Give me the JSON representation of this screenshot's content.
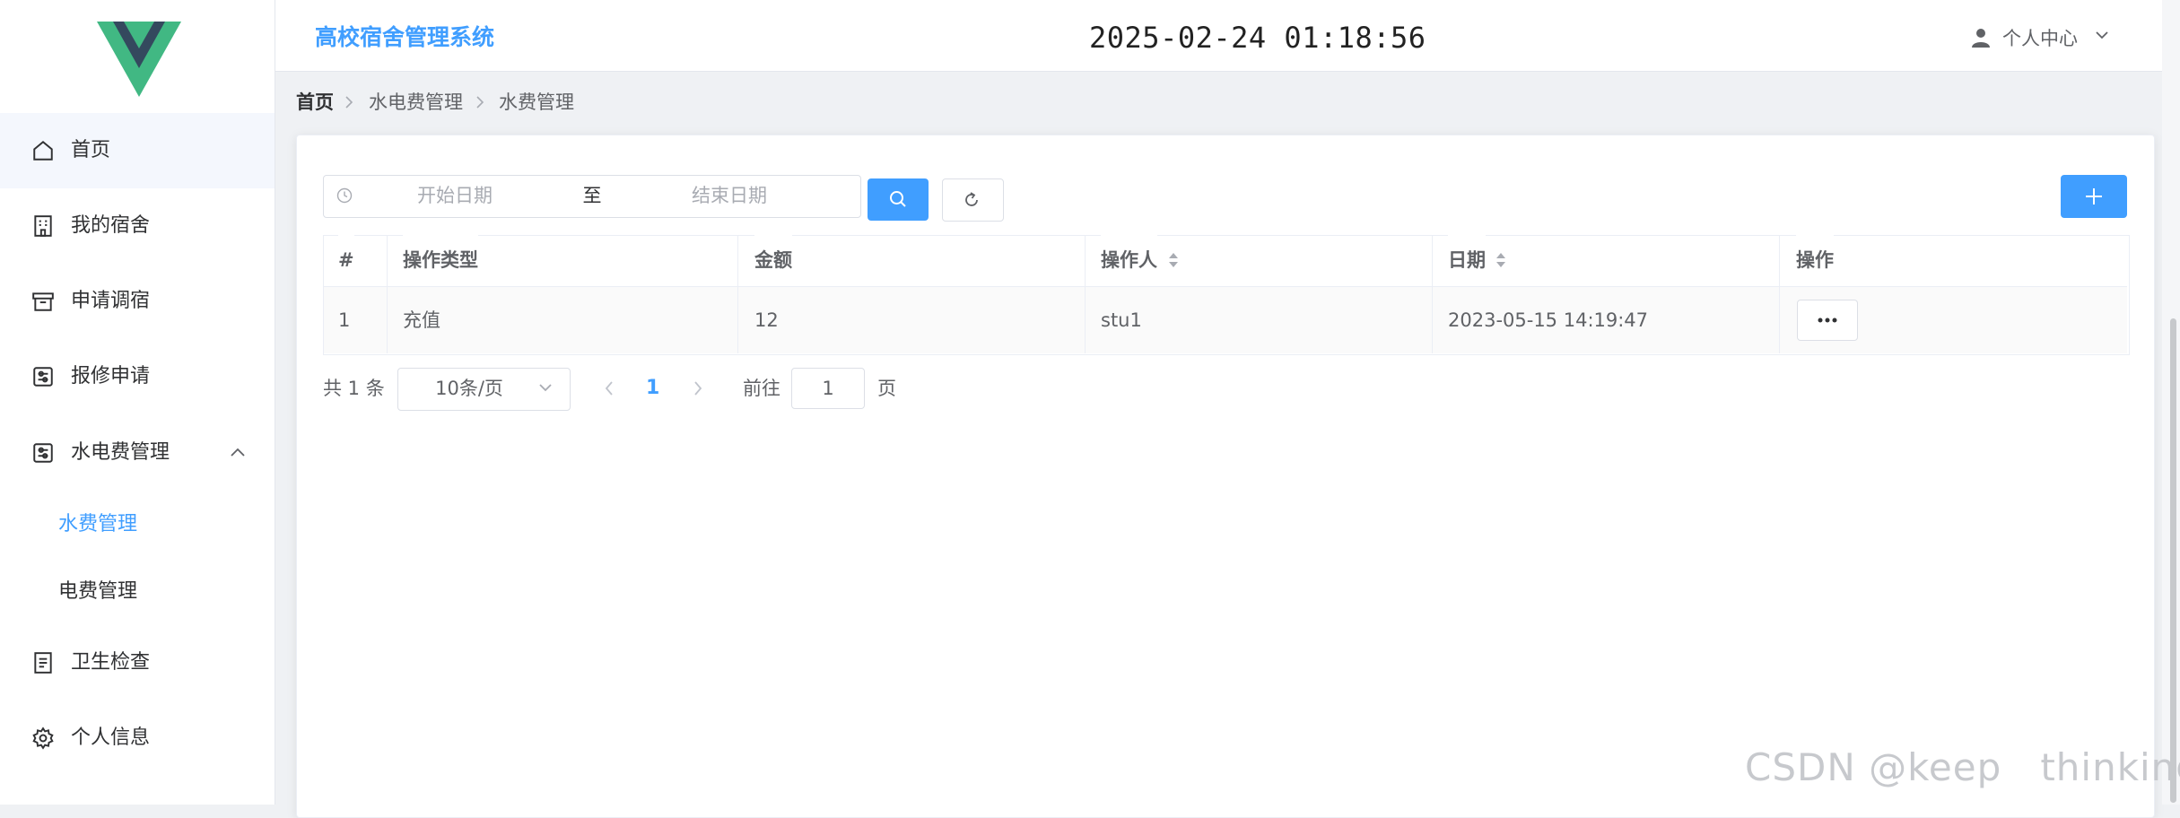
{
  "header": {
    "app_title": "高校宿舍管理系统",
    "datetime": "2025-02-24 01:18:56",
    "user_menu_label": "个人中心"
  },
  "sidebar": {
    "items": [
      {
        "label": "首页",
        "icon": "home-icon"
      },
      {
        "label": "我的宿舍",
        "icon": "building-icon"
      },
      {
        "label": "申请调宿",
        "icon": "box-icon"
      },
      {
        "label": "报修申请",
        "icon": "tools-icon"
      },
      {
        "label": "水电费管理",
        "icon": "tools-icon",
        "expanded": true,
        "children": [
          {
            "label": "水费管理",
            "active": true
          },
          {
            "label": "电费管理"
          }
        ]
      },
      {
        "label": "卫生检查",
        "icon": "document-icon"
      },
      {
        "label": "个人信息",
        "icon": "gear-icon"
      }
    ]
  },
  "breadcrumb": [
    "首页",
    "水电费管理",
    "水费管理"
  ],
  "filter": {
    "start_placeholder": "开始日期",
    "separator": "至",
    "end_placeholder": "结束日期"
  },
  "table": {
    "columns": [
      "#",
      "操作类型",
      "金额",
      "操作人",
      "日期",
      "操作"
    ],
    "rows": [
      {
        "index": "1",
        "type": "充值",
        "amount": "12",
        "operator": "stu1",
        "date": "2023-05-15 14:19:47"
      }
    ]
  },
  "pagination": {
    "total_text": "共 1 条",
    "page_size": "10条/页",
    "current_page": "1",
    "goto_label": "前往",
    "goto_value": "1",
    "page_suffix": "页"
  },
  "watermark": "CSDN @keep   thinking",
  "colors": {
    "accent": "#409eff",
    "sidebar_active_bg": "#f4f7fd",
    "text": "#303133",
    "muted": "#606266"
  }
}
